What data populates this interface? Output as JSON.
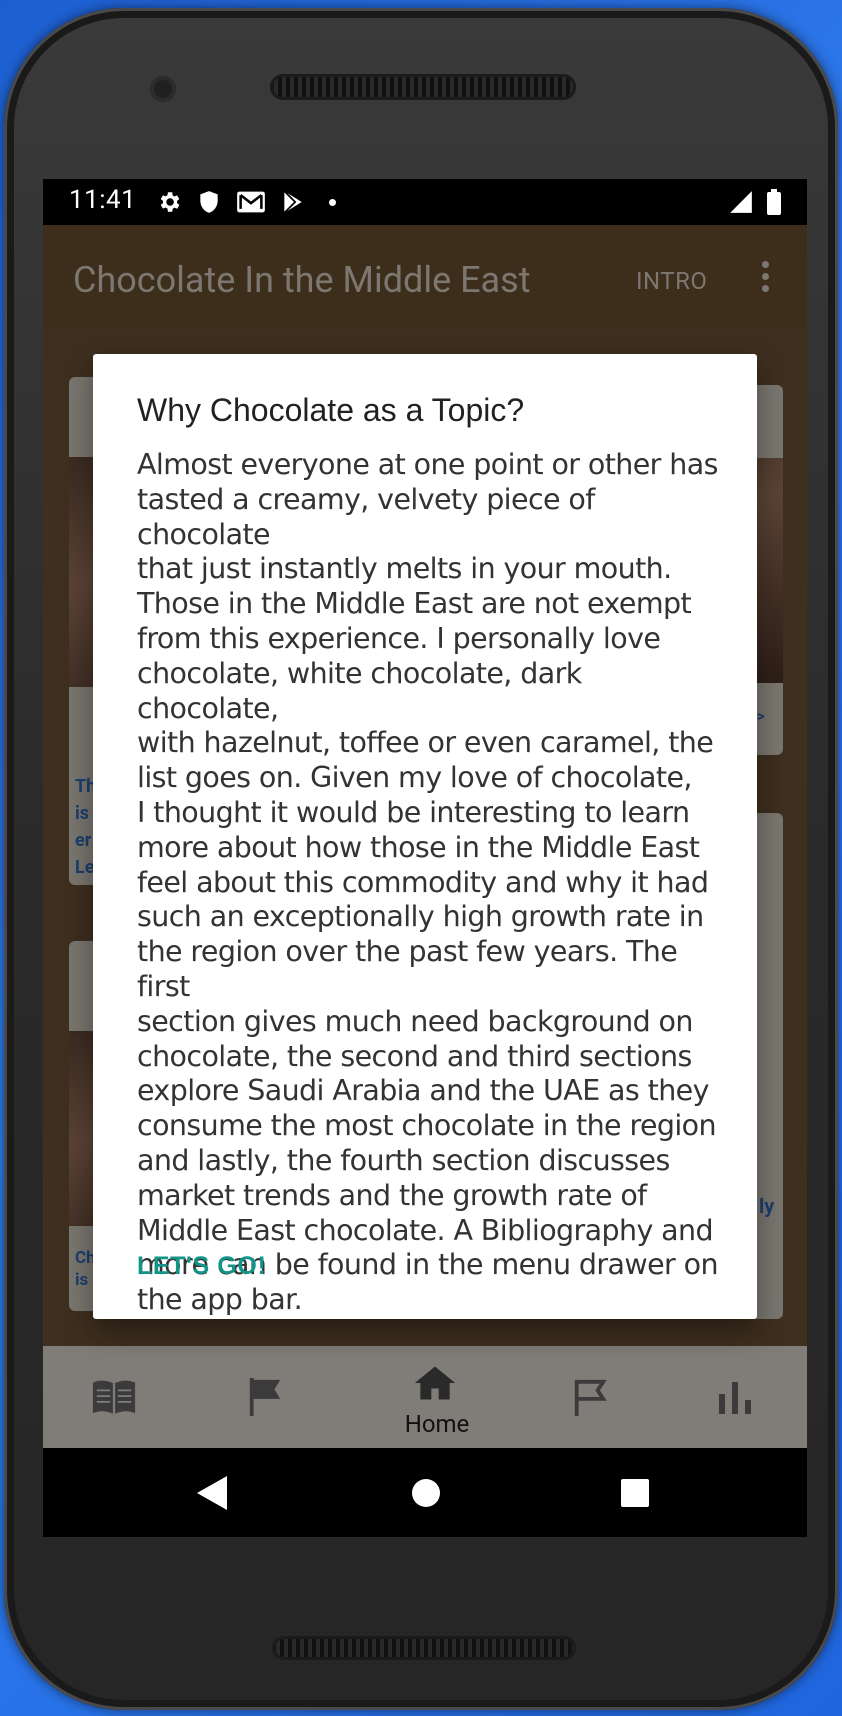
{
  "status_bar": {
    "time": "11:41",
    "icons": [
      "settings-icon",
      "shield-icon",
      "gmail-icon",
      "play-store-icon",
      "dot-icon",
      "signal-icon",
      "battery-icon"
    ]
  },
  "app_bar": {
    "title": "Chocolate In the Middle East",
    "action_label": "INTRO",
    "overflow_icon": "more-vert-icon"
  },
  "background_cards": {
    "left_top_text": [
      "Th",
      "is",
      "er",
      "Le"
    ],
    "left_bottom_text": [
      "Ch",
      "is"
    ],
    "right_top_link": "-->",
    "right_bottom_text": "ly"
  },
  "dialog": {
    "title": "Why Chocolate as a Topic?",
    "body": "Almost everyone at one point or other has\ntasted a creamy, velvety piece of chocolate\nthat just instantly melts in your mouth.\nThose in the Middle East are not exempt\nfrom this experience.  I personally love\nchocolate, white chocolate, dark chocolate,\nwith hazelnut, toffee or even caramel, the\nlist goes on.  Given my love of chocolate,\nI thought it would be interesting to learn\nmore about how those in the Middle East\nfeel about this commodity and why it had\nsuch an exceptionally high growth rate in\nthe region over the past few years. The first\nsection gives much need background on\nchocolate, the second and third sections\nexplore Saudi Arabia and the UAE as they\nconsume the most chocolate in the region\nand lastly, the fourth section discusses\nmarket trends and the growth rate of\nMiddle East chocolate.  A Bibliography and\nmore can be found in the menu drawer on\nthe app bar.",
    "button_label": "LET'S GO!"
  },
  "bottom_nav": {
    "items": [
      {
        "icon": "book-icon",
        "label": ""
      },
      {
        "icon": "flag-filled-icon",
        "label": ""
      },
      {
        "icon": "home-icon",
        "label": "Home"
      },
      {
        "icon": "flag-outline-icon",
        "label": ""
      },
      {
        "icon": "bar-chart-icon",
        "label": ""
      }
    ]
  },
  "system_nav": [
    "back-icon",
    "home-circle-icon",
    "recents-icon"
  ],
  "colors": {
    "accent": "#149488",
    "app_bar_dimmed": "#3d2e1c",
    "background": "#2f7cf0"
  }
}
